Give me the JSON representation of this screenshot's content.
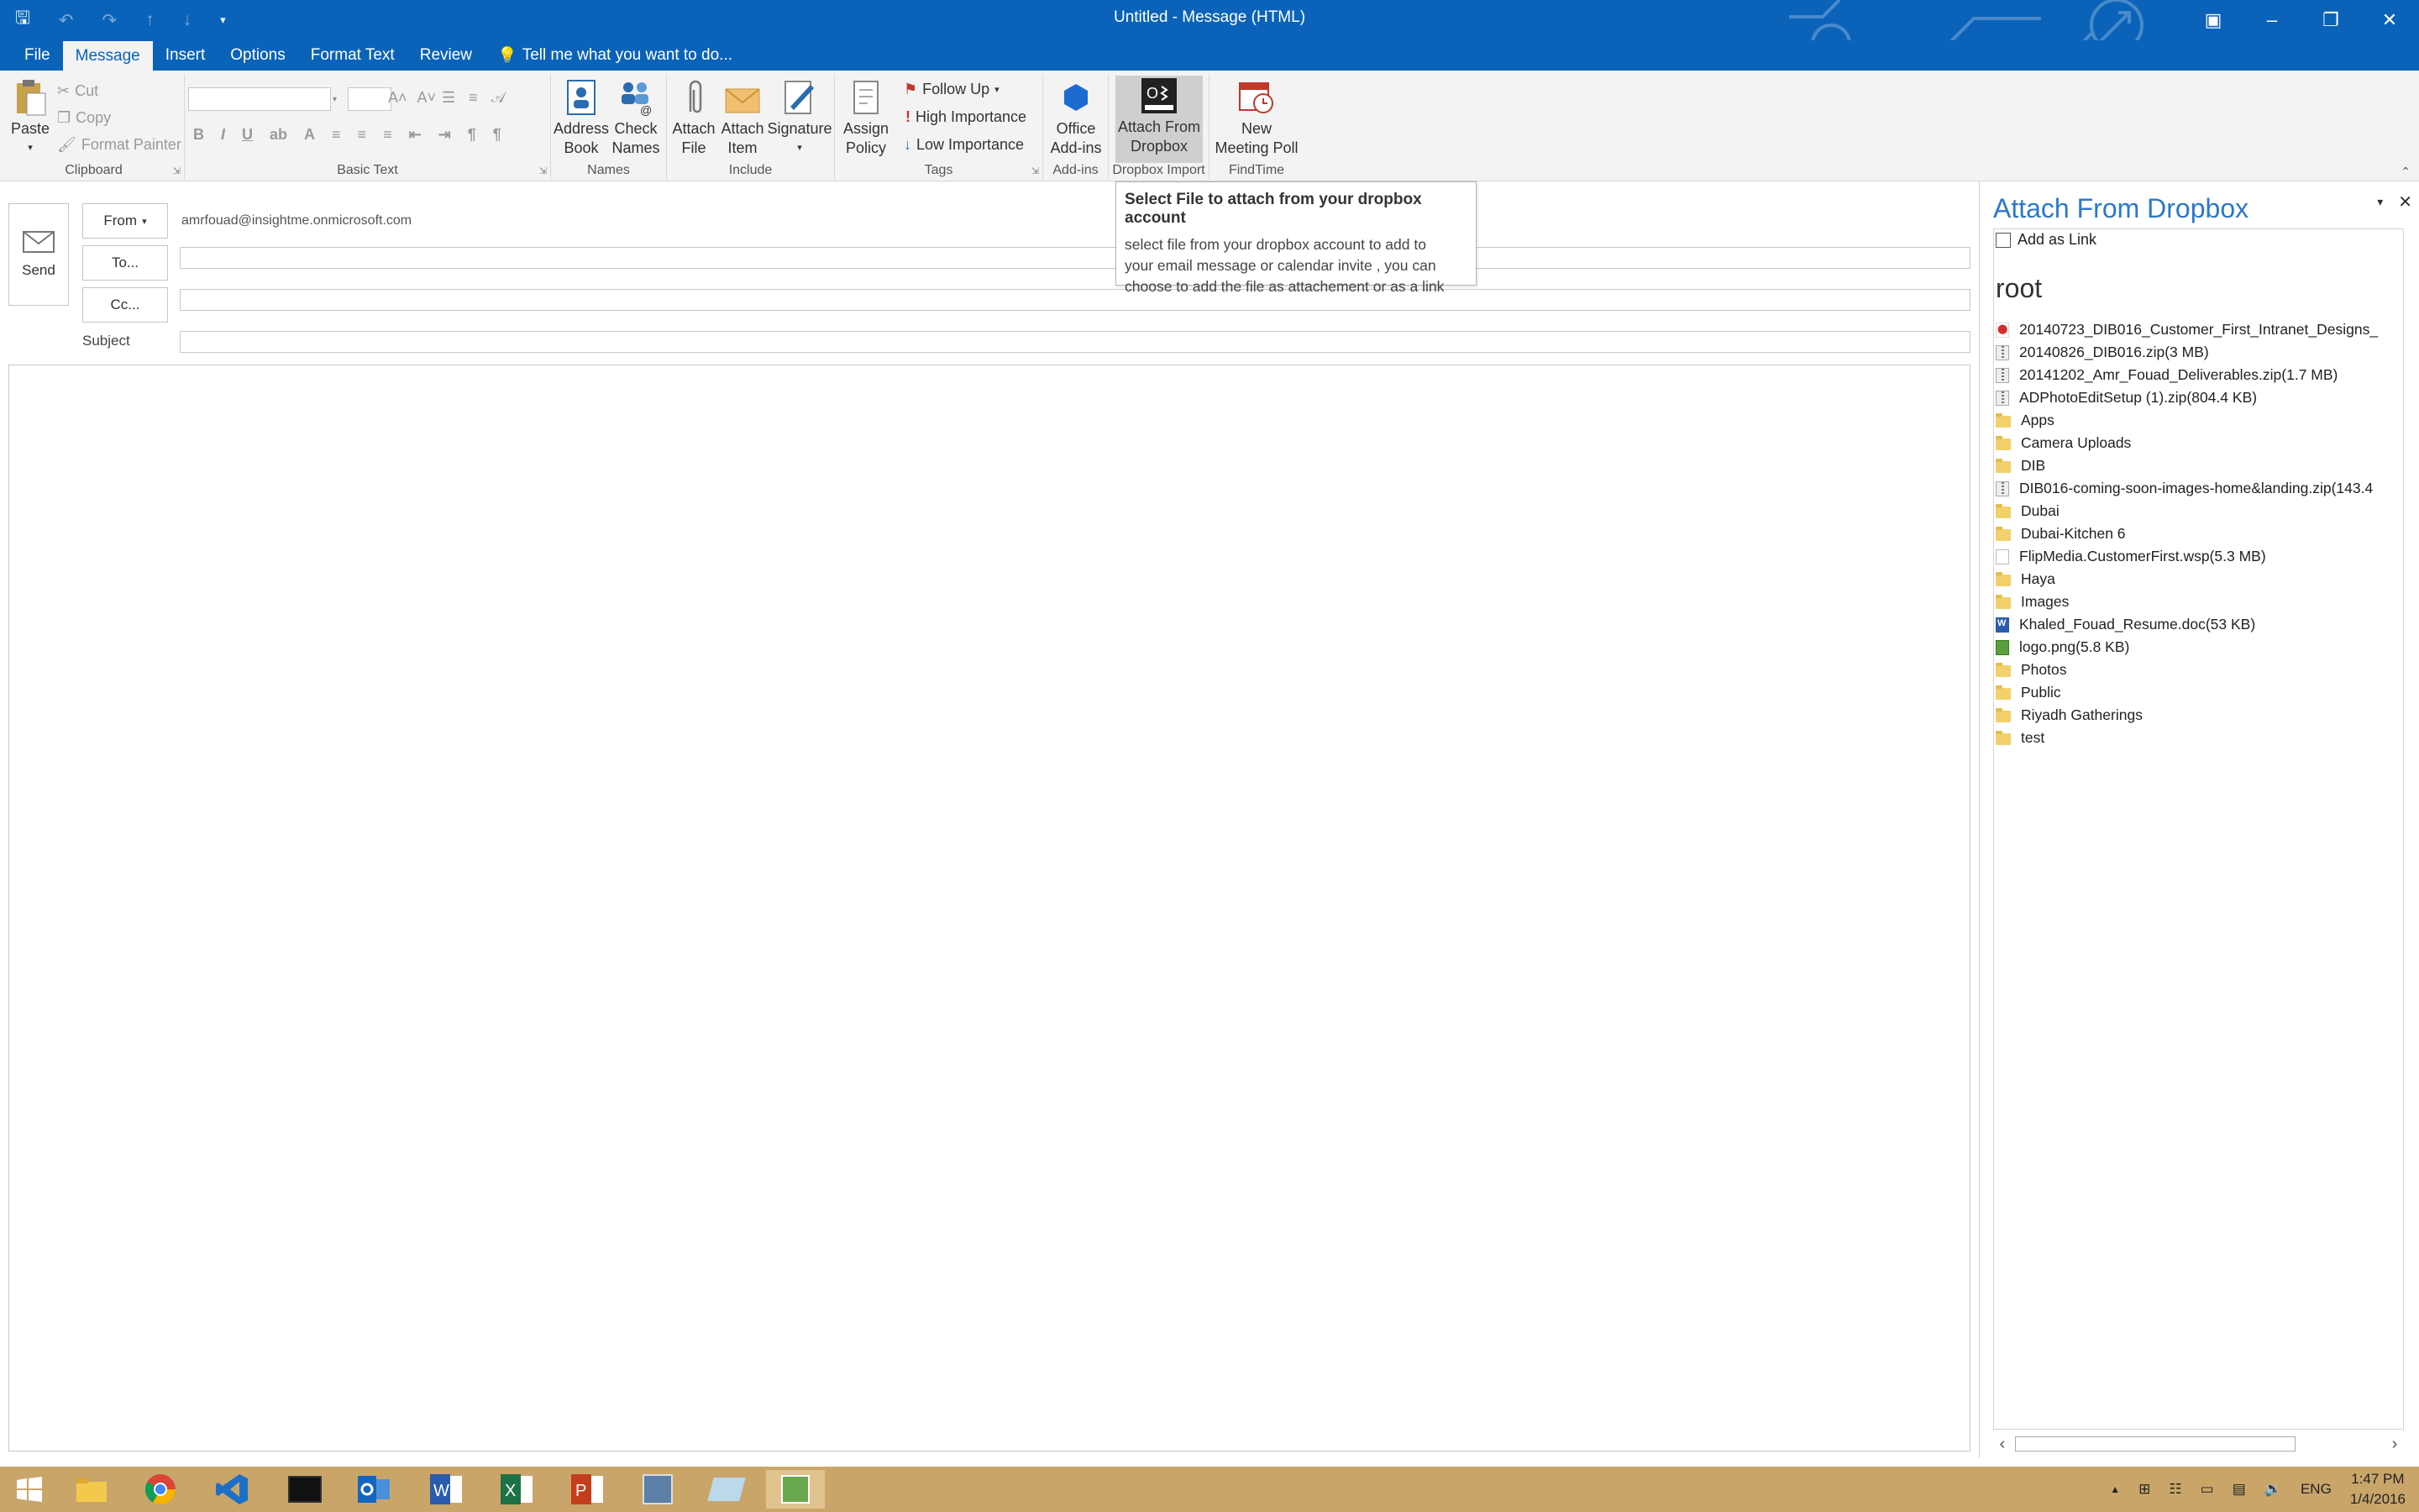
{
  "titlebar": {
    "title": "Untitled - Message (HTML)",
    "qat_icons": [
      "save-icon",
      "undo-icon",
      "redo-icon",
      "up-arrow-icon",
      "down-arrow-icon",
      "customize-icon"
    ]
  },
  "tabs": [
    {
      "label": "File"
    },
    {
      "label": "Message"
    },
    {
      "label": "Insert"
    },
    {
      "label": "Options"
    },
    {
      "label": "Format Text"
    },
    {
      "label": "Review"
    }
  ],
  "tell_me": "Tell me what you want to do...",
  "ribbon": {
    "clipboard": {
      "label": "Clipboard",
      "paste": "Paste",
      "cut": "Cut",
      "copy": "Copy",
      "format_painter": "Format Painter"
    },
    "basic_text": {
      "label": "Basic Text"
    },
    "names": {
      "label": "Names",
      "address_book_1": "Address",
      "address_book_2": "Book",
      "check_names_1": "Check",
      "check_names_2": "Names"
    },
    "include": {
      "label": "Include",
      "attach_file_1": "Attach",
      "attach_file_2": "File",
      "attach_item_1": "Attach",
      "attach_item_2": "Item",
      "signature": "Signature"
    },
    "tags": {
      "label": "Tags",
      "assign_policy_1": "Assign",
      "assign_policy_2": "Policy",
      "follow_up": "Follow Up",
      "high_importance": "High Importance",
      "low_importance": "Low Importance"
    },
    "addins": {
      "label": "Add-ins",
      "office_addins_1": "Office",
      "office_addins_2": "Add-ins"
    },
    "dropbox": {
      "label": "Dropbox Import",
      "attach_1": "Attach From",
      "attach_2": "Dropbox"
    },
    "findtime": {
      "label": "FindTime",
      "poll_1": "New",
      "poll_2": "Meeting Poll"
    }
  },
  "compose": {
    "send": "Send",
    "from": "From",
    "from_value": "amrfouad@insightme.onmicrosoft.com",
    "to": "To...",
    "cc": "Cc...",
    "subject": "Subject"
  },
  "tooltip": {
    "title": "Select File to attach from your dropbox account",
    "line1": "select file from your dropbox account to add to",
    "line2": "your email message or calendar invite , you can",
    "line3": "choose to add the file as attachement or as a link"
  },
  "pane": {
    "title": "Attach From Dropbox",
    "add_as_link": "Add as Link",
    "root": "root",
    "files": [
      {
        "name": "20140723_DIB016_Customer_First_Intranet_Designs_",
        "icon": "pdf"
      },
      {
        "name": "20140826_DIB016.zip(3 MB)",
        "icon": "zip"
      },
      {
        "name": "20141202_Amr_Fouad_Deliverables.zip(1.7 MB)",
        "icon": "zip"
      },
      {
        "name": "ADPhotoEditSetup (1).zip(804.4 KB)",
        "icon": "zip"
      },
      {
        "name": "Apps",
        "icon": "folder"
      },
      {
        "name": "Camera Uploads",
        "icon": "folder"
      },
      {
        "name": "DIB",
        "icon": "folder"
      },
      {
        "name": "DIB016-coming-soon-images-home&landing.zip(143.4",
        "icon": "zip"
      },
      {
        "name": "Dubai",
        "icon": "folder"
      },
      {
        "name": "Dubai-Kitchen 6",
        "icon": "folder"
      },
      {
        "name": "FlipMedia.CustomerFirst.wsp(5.3 MB)",
        "icon": "generic"
      },
      {
        "name": "Haya",
        "icon": "folder"
      },
      {
        "name": "Images",
        "icon": "folder"
      },
      {
        "name": "Khaled_Fouad_Resume.doc(53 KB)",
        "icon": "doc"
      },
      {
        "name": "logo.png(5.8 KB)",
        "icon": "img"
      },
      {
        "name": "Photos",
        "icon": "folder"
      },
      {
        "name": "Public",
        "icon": "folder"
      },
      {
        "name": "Riyadh Gatherings",
        "icon": "folder"
      },
      {
        "name": "test",
        "icon": "folder"
      }
    ]
  },
  "taskbar": {
    "apps": [
      "start-icon",
      "file-explorer-icon",
      "chrome-icon",
      "visual-studio-icon",
      "terminal-icon",
      "outlook-icon",
      "word-icon",
      "excel-icon",
      "powerpoint-icon",
      "app-icon",
      "notes-icon",
      "app2-icon"
    ],
    "lang": "ENG",
    "time": "1:47 PM",
    "date": "1/4/2016"
  },
  "colors": {
    "accent": "#0a63b8",
    "pane_title": "#2b79c6",
    "taskbar": "#c9a56a"
  }
}
